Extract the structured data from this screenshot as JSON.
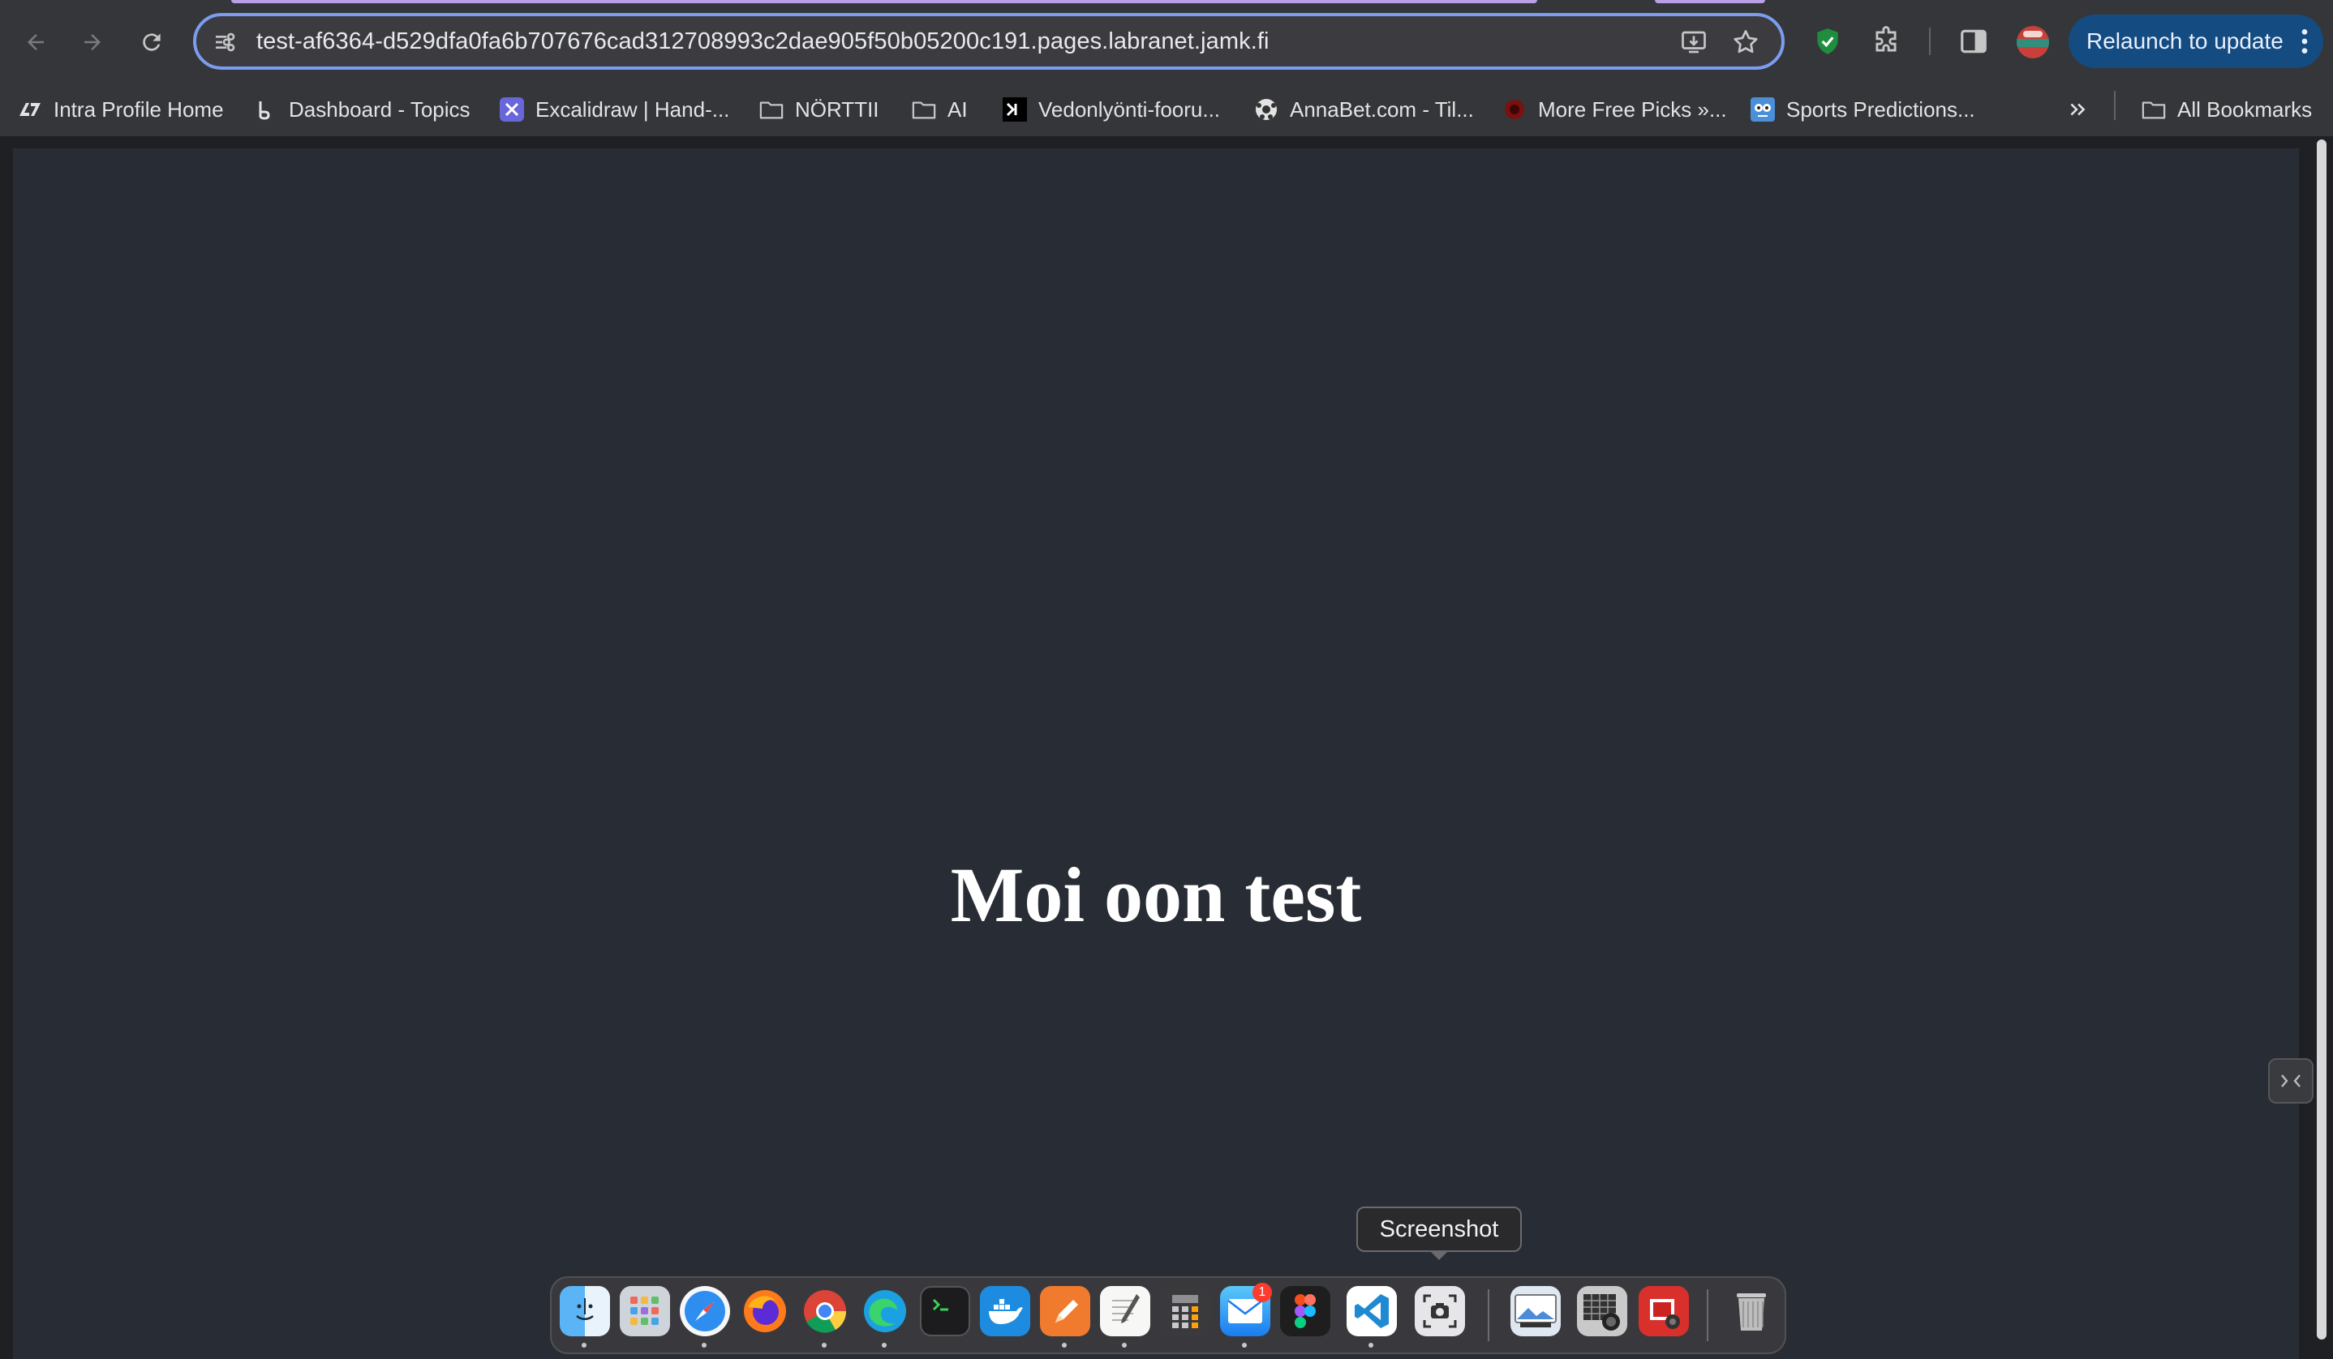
{
  "browser": {
    "address": "test-af6364-d529dfa0fa6b707676cad312708993c2dae905f50b05200c191.pages.labranet.jamk.fi",
    "relaunch_label": "Relaunch to update"
  },
  "bookmarks": {
    "items": [
      {
        "label": "Intra Profile Home",
        "icon": "intra-logo-icon"
      },
      {
        "label": "Dashboard - Topics",
        "icon": "dashboard-icon"
      },
      {
        "label": "Excalidraw | Hand-...",
        "icon": "excalidraw-icon"
      },
      {
        "label": "NÖRTTII",
        "icon": "folder-icon"
      },
      {
        "label": "AI",
        "icon": "folder-icon"
      },
      {
        "label": "Vedonlyönti-fooru...",
        "icon": "terminal-icon"
      },
      {
        "label": "AnnaBet.com - Til...",
        "icon": "soccer-ball-icon"
      },
      {
        "label": "More Free Picks »...",
        "icon": "site-icon"
      },
      {
        "label": "Sports Predictions...",
        "icon": "robot-icon"
      }
    ],
    "all_label": "All Bookmarks"
  },
  "page": {
    "heading": "Moi oon test"
  },
  "dock": {
    "tooltip": "Screenshot",
    "mail_badge": "1",
    "apps": [
      "finder",
      "launchpad",
      "safari",
      "firefox",
      "chrome",
      "edge",
      "terminal",
      "docker",
      "pages",
      "textedit",
      "calculator",
      "mail",
      "figma",
      "vscode",
      "screenshot",
      "preview",
      "image-capture",
      "photo-booth",
      "trash"
    ]
  },
  "colors": {
    "page_background": "#282c34",
    "heading": "#ffffff",
    "toolbar": "#35363a",
    "relaunch_button": "#144b80",
    "omnibox_border": "#7c9cf0"
  }
}
